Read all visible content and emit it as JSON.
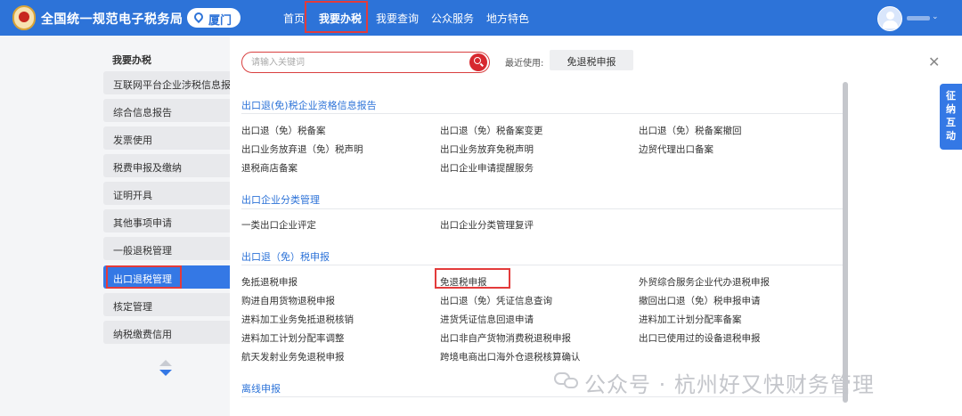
{
  "header": {
    "site_title": "全国统一规范电子税务局",
    "city": "厦门",
    "nav": [
      {
        "label": "首页"
      },
      {
        "label": "我要办税"
      },
      {
        "label": "我要查询"
      },
      {
        "label": "公众服务"
      },
      {
        "label": "地方特色"
      }
    ],
    "active_nav": "我要办税"
  },
  "sidebar": {
    "title": "我要办税",
    "items": [
      {
        "label": "互联网平台企业涉税信息报送"
      },
      {
        "label": "综合信息报告"
      },
      {
        "label": "发票使用"
      },
      {
        "label": "税费申报及缴纳"
      },
      {
        "label": "证明开具"
      },
      {
        "label": "其他事项申请"
      },
      {
        "label": "一般退税管理"
      },
      {
        "label": "出口退税管理"
      },
      {
        "label": "核定管理"
      },
      {
        "label": "纳税缴费信用"
      }
    ],
    "active_item": "出口退税管理"
  },
  "main": {
    "search_placeholder": "请输入关键词",
    "recent_label": "最近使用:",
    "recent_item": "免退税申报",
    "sections": [
      {
        "title": "出口退(免)税企业资格信息报告",
        "links": [
          "出口退（免）税备案",
          "出口退（免）税备案变更",
          "出口退（免）税备案撤回",
          "出口业务放弃退（免）税声明",
          "出口业务放弃免税声明",
          "边贸代理出口备案",
          "退税商店备案",
          "出口企业申请提醒服务"
        ]
      },
      {
        "title": "出口企业分类管理",
        "links": [
          "一类出口企业评定",
          "出口企业分类管理复评"
        ]
      },
      {
        "title": "出口退（免）税申报",
        "links": [
          "免抵退税申报",
          "免退税申报",
          "外贸综合服务企业代办退税申报",
          "购进自用货物退税申报",
          "出口退（免）凭证信息查询",
          "撤回出口退（免）税申报申请",
          "进料加工业务免抵退税核销",
          "进货凭证信息回退申请",
          "进料加工计划分配率备案",
          "进料加工计划分配率调整",
          "出口非自产货物消费税退税申报",
          "出口已使用过的设备退税申报",
          "航天发射业务免退税申报",
          "跨境电商出口海外仓退税核算确认"
        ]
      },
      {
        "title": "离线申报",
        "links": []
      }
    ]
  },
  "float_tab": {
    "chars": [
      "征",
      "纳",
      "互",
      "动"
    ]
  },
  "watermark": "公众号 · 杭州好又快财务管理",
  "colors": {
    "primary": "#2d73d8",
    "sidebar_active": "#3478e5",
    "highlight": "#e33b3b",
    "search_btn": "#d7282f"
  }
}
